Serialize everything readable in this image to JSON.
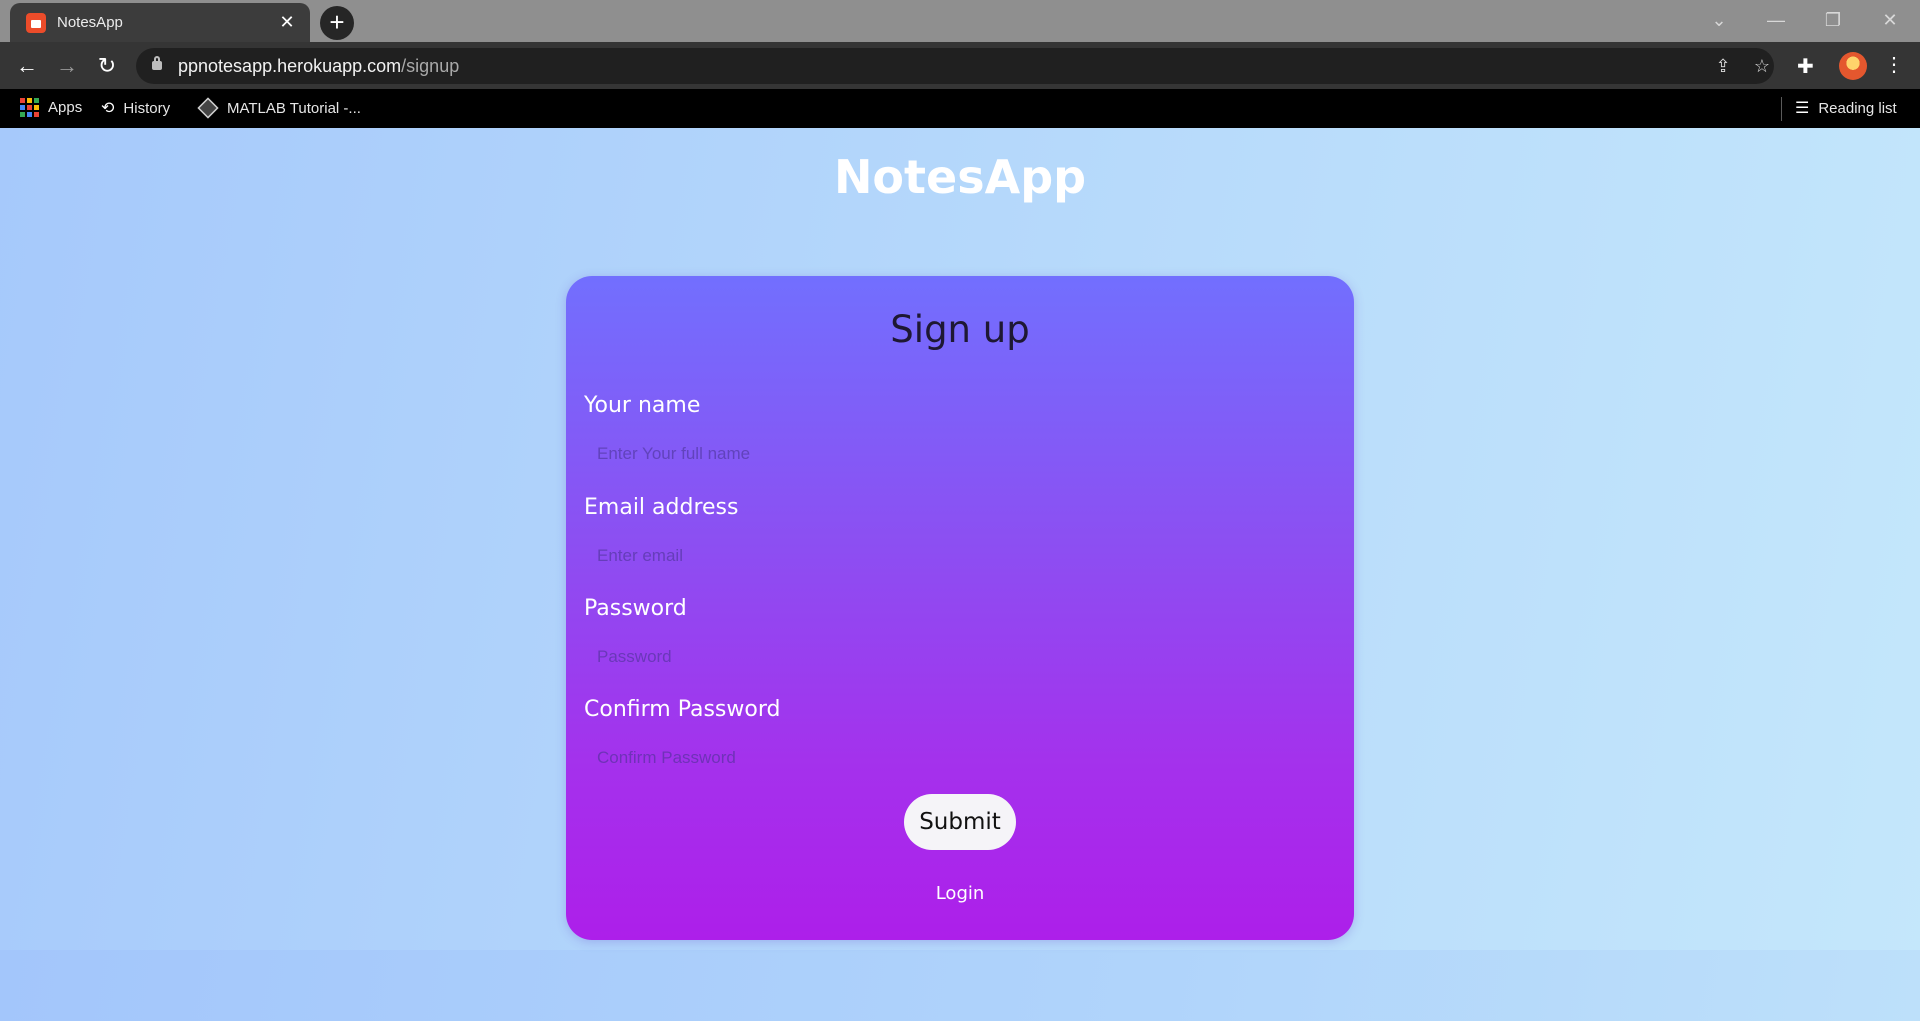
{
  "browser": {
    "tab_title": "NotesApp",
    "tab_close": "✕",
    "new_tab": "+",
    "url_host": "ppnotesapp.herokuapp.com",
    "url_path": "/signup",
    "bookmarks": {
      "apps": "Apps",
      "history": "History",
      "matlab": "MATLAB Tutorial -...",
      "reading_list": "Reading list"
    }
  },
  "page": {
    "app_title": "NotesApp",
    "form": {
      "title": "Sign up",
      "name_label": "Your name",
      "name_placeholder": "Enter Your full name",
      "email_label": "Email address",
      "email_placeholder": "Enter email",
      "password_label": "Password",
      "password_placeholder": "Password",
      "confirm_label": "Confirm Password",
      "confirm_placeholder": "Confirm Password",
      "submit": "Submit",
      "login": "Login"
    }
  },
  "colors": {
    "card_top": "#726ffe",
    "card_bottom": "#ad1fea",
    "page_bg": "#b7dafb"
  }
}
